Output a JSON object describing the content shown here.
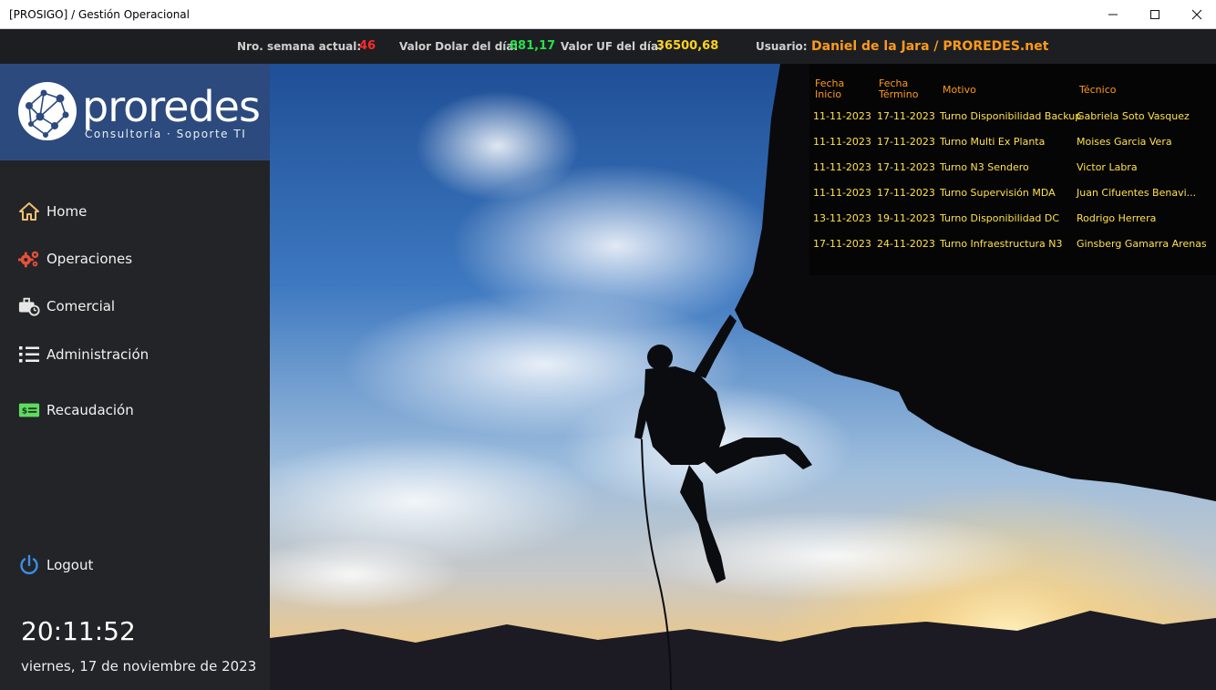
{
  "window": {
    "title": "[PROSIGO]  / Gestión Operacional"
  },
  "status": {
    "week_label": "Nro. semana actual:",
    "week_value": "46",
    "dolar_label": "Valor Dolar del día:",
    "dolar_value": "881,17",
    "uf_label": "Valor UF del día:",
    "uf_value": "36500,68",
    "user_label": "Usuario:",
    "user_value": "Daniel de la Jara / PROREDES.net"
  },
  "logo": {
    "name": "proredes",
    "tagline": "Consultoría  ·  Soporte TI"
  },
  "nav": [
    {
      "label": "Home",
      "icon": "home-icon"
    },
    {
      "label": "Operaciones",
      "icon": "gears-icon"
    },
    {
      "label": "Comercial",
      "icon": "briefcase-clock-icon"
    },
    {
      "label": "Administración",
      "icon": "list-icon"
    },
    {
      "label": "Recaudación",
      "icon": "money-card-icon"
    }
  ],
  "logout": {
    "label": "Logout",
    "icon": "power-icon"
  },
  "clock": {
    "time": "20:11:52",
    "date": "viernes, 17 de noviembre de 2023"
  },
  "table": {
    "headers": [
      "Fecha\nInicio",
      "Fecha\nTérmino",
      "Motivo",
      "Técnico"
    ],
    "rows": [
      [
        "11-11-2023",
        "17-11-2023",
        "Turno Disponibilidad Backup",
        "Gabriela Soto Vasquez"
      ],
      [
        "11-11-2023",
        "17-11-2023",
        "Turno Multi Ex Planta",
        "Moises Garcia Vera"
      ],
      [
        "11-11-2023",
        "17-11-2023",
        "Turno N3 Sendero",
        "Victor Labra"
      ],
      [
        "11-11-2023",
        "17-11-2023",
        "Turno Supervisión MDA",
        "Juan Cifuentes Benavi..."
      ],
      [
        "13-11-2023",
        "19-11-2023",
        "Turno Disponibilidad DC",
        "Rodrigo Herrera"
      ],
      [
        "17-11-2023",
        "24-11-2023",
        "Turno Infraestructura N3",
        "Ginsberg Gamarra Arenas"
      ]
    ]
  },
  "colors": {
    "sidebar": "#232427",
    "logo_bg": "#2c4a7d",
    "header_text": "#ff9a1a",
    "cell_text": "#ffe14a"
  }
}
